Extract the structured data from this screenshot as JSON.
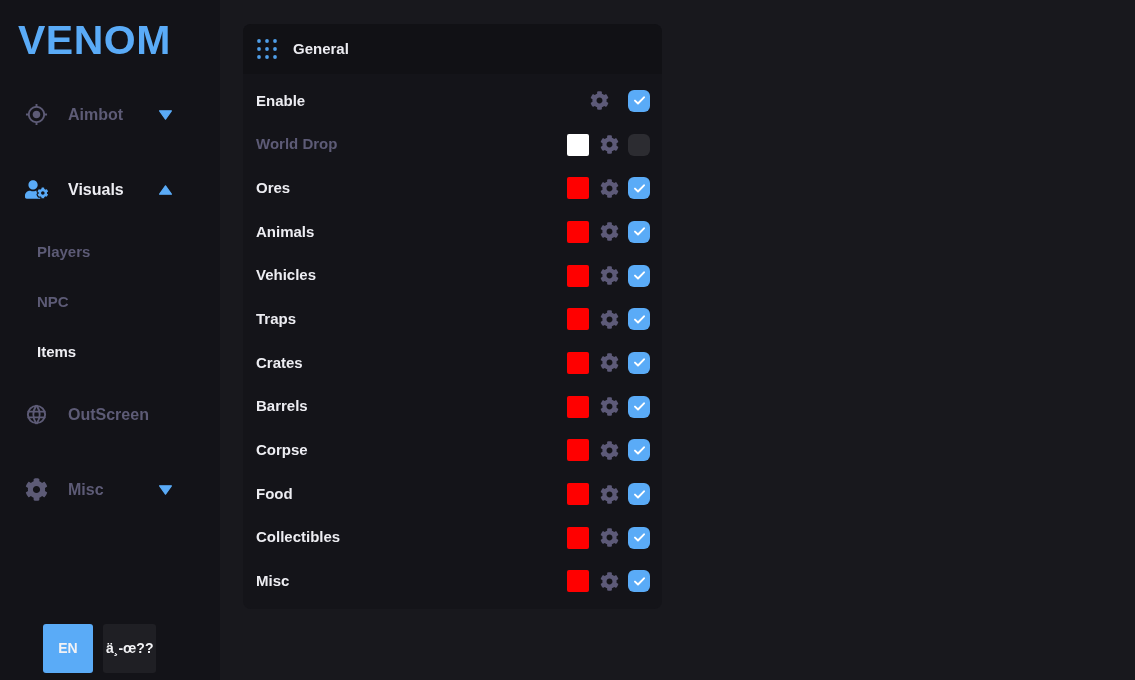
{
  "logo": "VENOM",
  "nav": [
    {
      "label": "Aimbot",
      "selected": false,
      "expanded": false
    },
    {
      "label": "Visuals",
      "selected": true,
      "expanded": true,
      "children": [
        {
          "label": "Players",
          "selected": false
        },
        {
          "label": "NPC",
          "selected": false
        },
        {
          "label": "Items",
          "selected": true
        }
      ]
    },
    {
      "label": "OutScreen",
      "selected": false
    },
    {
      "label": "Misc",
      "selected": false,
      "expanded": false
    }
  ],
  "languages": [
    {
      "label": "EN",
      "selected": true
    },
    {
      "label": "ä¸-œ??",
      "selected": false
    }
  ],
  "panel": {
    "title": "General",
    "rows": [
      {
        "label": "Enable",
        "checked": true
      },
      {
        "label": "World Drop",
        "color": "#ffffff",
        "checked": false
      },
      {
        "label": "Ores",
        "color": "#ff0000",
        "checked": true
      },
      {
        "label": "Animals",
        "color": "#ff0000",
        "checked": true
      },
      {
        "label": "Vehicles",
        "color": "#ff0000",
        "checked": true
      },
      {
        "label": "Traps",
        "color": "#ff0000",
        "checked": true
      },
      {
        "label": "Crates",
        "color": "#ff0000",
        "checked": true
      },
      {
        "label": "Barrels",
        "color": "#ff0000",
        "checked": true
      },
      {
        "label": "Corpse",
        "color": "#ff0000",
        "checked": true
      },
      {
        "label": "Food",
        "color": "#ff0000",
        "checked": true
      },
      {
        "label": "Collectibles",
        "color": "#ff0000",
        "checked": true
      },
      {
        "label": "Misc",
        "color": "#ff0000",
        "checked": true
      }
    ]
  }
}
